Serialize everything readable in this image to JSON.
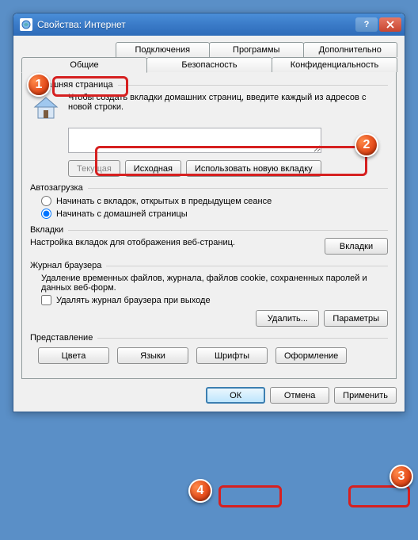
{
  "window": {
    "title": "Свойства: Интернет"
  },
  "tabs_row1": {
    "hidden": "—",
    "connections": "Подключения",
    "programs": "Программы",
    "advanced": "Дополнительно"
  },
  "tabs_row2": {
    "general": "Общие",
    "security": "Безопасность",
    "privacy": "Конфиденциальность"
  },
  "home": {
    "group": "Домашняя страница",
    "text": "Чтобы создать вкладки домашних страниц, введите каждый из адресов с новой строки.",
    "url_value": "",
    "current": "Текущая",
    "default": "Исходная",
    "newtab": "Использовать новую вкладку"
  },
  "startup": {
    "group": "Автозагрузка",
    "opt_tabs": "Начинать с вкладок, открытых в предыдущем сеансе",
    "opt_home": "Начинать с домашней страницы"
  },
  "tabs_sec": {
    "group": "Вкладки",
    "text": "Настройка вкладок для отображения веб-страниц.",
    "btn": "Вкладки"
  },
  "history": {
    "group": "Журнал браузера",
    "text": "Удаление временных файлов, журнала, файлов cookie, сохраненных паролей и данных веб-форм.",
    "chk": "Удалять журнал браузера при выходе",
    "del": "Удалить...",
    "settings": "Параметры"
  },
  "presentation": {
    "group": "Представление",
    "colors": "Цвета",
    "languages": "Языки",
    "fonts": "Шрифты",
    "accessibility": "Оформление"
  },
  "footer": {
    "ok": "ОК",
    "cancel": "Отмена",
    "apply": "Применить"
  },
  "callouts": {
    "c1": "1",
    "c2": "2",
    "c3": "3",
    "c4": "4"
  }
}
